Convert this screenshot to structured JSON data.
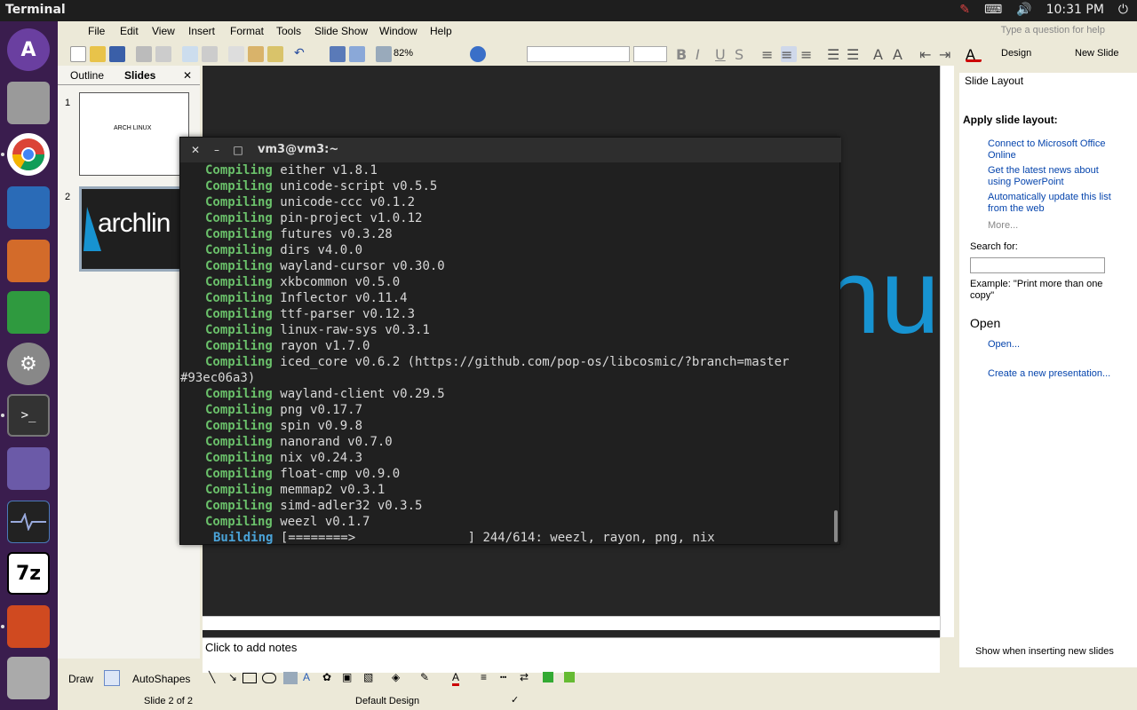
{
  "topbar": {
    "app_title": "Terminal",
    "time": "10:31 PM"
  },
  "launcher": {
    "items": [
      "archlinux-icon",
      "files-icon",
      "chrome-icon",
      "writer-icon",
      "impress-icon",
      "calc-icon",
      "settings-icon",
      "terminal-icon",
      "folder-icon",
      "system-monitor-icon",
      "7zip-icon",
      "powerpoint-icon",
      "drive-icon"
    ]
  },
  "ppt": {
    "menu": [
      "File",
      "Edit",
      "View",
      "Insert",
      "Format",
      "Tools",
      "Slide Show",
      "Window",
      "Help"
    ],
    "help_placeholder": "Type a question for help",
    "zoom": "82%",
    "toolbar_text": {
      "design": "Design",
      "new_slide": "New Slide"
    },
    "left_tabs": {
      "outline": "Outline",
      "slides": "Slides"
    },
    "slides": [
      {
        "num": "1",
        "text": "ARCH LINUX"
      },
      {
        "num": "2",
        "text": "archlin"
      }
    ],
    "notes_placeholder": "Click to add notes",
    "drawbar": {
      "draw": "Draw",
      "autoshapes": "AutoShapes"
    },
    "status": {
      "slide": "Slide 2 of 2",
      "design": "Default Design"
    },
    "taskpane": {
      "title": "Slide Layout",
      "apply_label": "Apply slide layout:",
      "links": [
        "Connect to Microsoft Office Online",
        "Get the latest news about using PowerPoint",
        "Automatically update this list from the web"
      ],
      "more": "More...",
      "search_label": "Search for:",
      "example": "Example:  \"Print more than one copy\"",
      "open_header": "Open",
      "open_link": "Open...",
      "create_link": "Create a new presentation...",
      "show_checkbox": "Show when inserting new slides"
    },
    "slide_partial_text": "nu"
  },
  "terminal": {
    "title": "vm3@vm3:~",
    "lines": [
      {
        "kw": "Compiling",
        "rest": "either v1.8.1"
      },
      {
        "kw": "Compiling",
        "rest": "unicode-script v0.5.5"
      },
      {
        "kw": "Compiling",
        "rest": "unicode-ccc v0.1.2"
      },
      {
        "kw": "Compiling",
        "rest": "pin-project v1.0.12"
      },
      {
        "kw": "Compiling",
        "rest": "futures v0.3.28"
      },
      {
        "kw": "Compiling",
        "rest": "dirs v4.0.0"
      },
      {
        "kw": "Compiling",
        "rest": "wayland-cursor v0.30.0"
      },
      {
        "kw": "Compiling",
        "rest": "xkbcommon v0.5.0"
      },
      {
        "kw": "Compiling",
        "rest": "Inflector v0.11.4"
      },
      {
        "kw": "Compiling",
        "rest": "ttf-parser v0.12.3"
      },
      {
        "kw": "Compiling",
        "rest": "linux-raw-sys v0.3.1"
      },
      {
        "kw": "Compiling",
        "rest": "rayon v1.7.0"
      },
      {
        "kw": "Compiling",
        "rest": "iced_core v0.6.2 (https://github.com/pop-os/libcosmic/?branch=master"
      },
      {
        "kw": "",
        "rest": "#93ec06a3)"
      },
      {
        "kw": "Compiling",
        "rest": "wayland-client v0.29.5"
      },
      {
        "kw": "Compiling",
        "rest": "png v0.17.7"
      },
      {
        "kw": "Compiling",
        "rest": "spin v0.9.8"
      },
      {
        "kw": "Compiling",
        "rest": "nanorand v0.7.0"
      },
      {
        "kw": "Compiling",
        "rest": "nix v0.24.3"
      },
      {
        "kw": "Compiling",
        "rest": "float-cmp v0.9.0"
      },
      {
        "kw": "Compiling",
        "rest": "memmap2 v0.3.1"
      },
      {
        "kw": "Compiling",
        "rest": "simd-adler32 v0.3.5"
      },
      {
        "kw": "Compiling",
        "rest": "weezl v0.1.7"
      }
    ],
    "building": {
      "kw": "Building",
      "rest": "[========>               ] 244/614: weezl, rayon, png, nix"
    }
  }
}
